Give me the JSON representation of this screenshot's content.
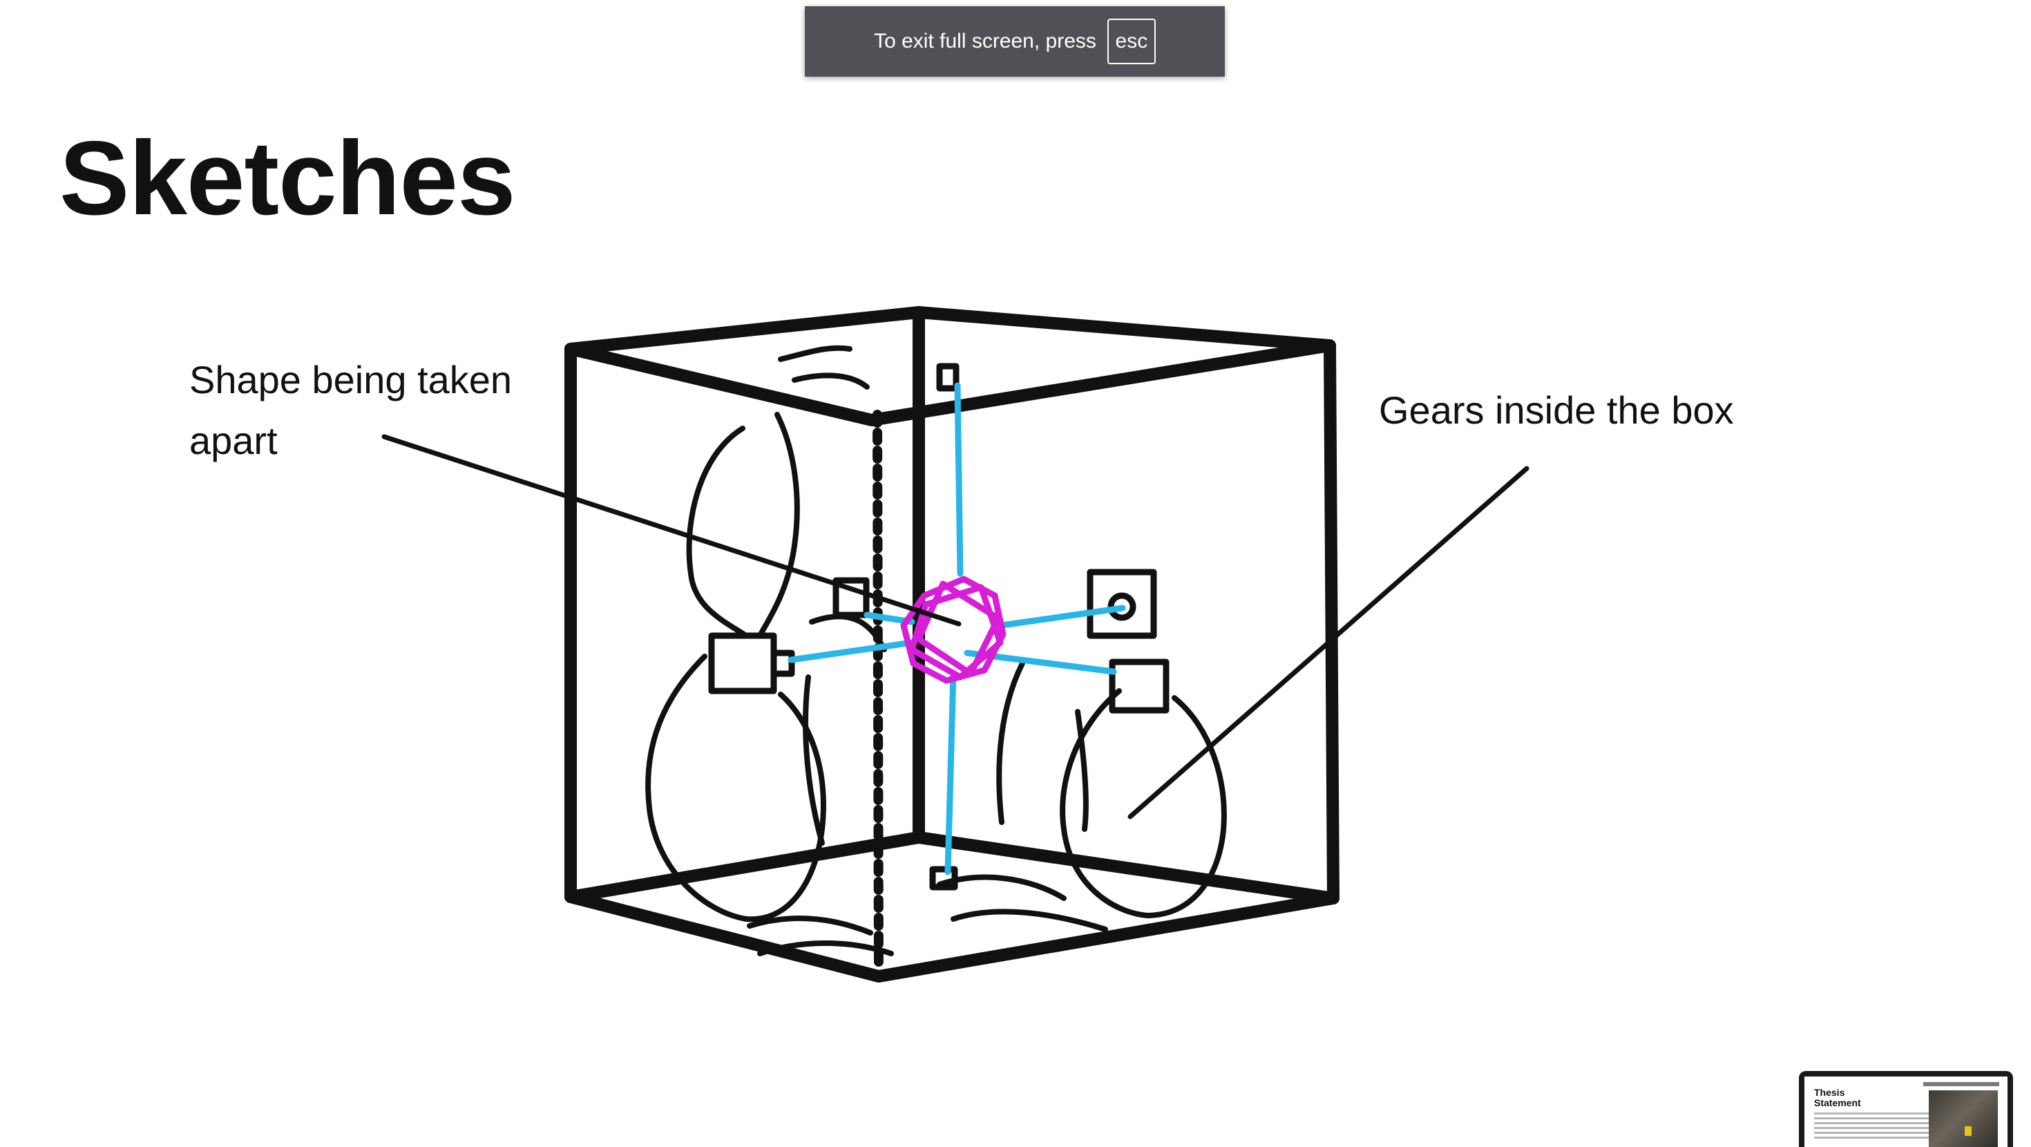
{
  "fullscreen_notice": {
    "text": "To exit full screen, press",
    "key": "esc"
  },
  "slide": {
    "title": "Sketches",
    "annotations": {
      "left": [
        "Shape being taken",
        "apart"
      ],
      "right": "Gears inside the box"
    }
  },
  "thumbnail": {
    "title_line1": "Thesis",
    "title_line2": "Statement"
  },
  "colors": {
    "ink": "#111111",
    "axis_blue": "#29b6e6",
    "shape_magenta": "#d61fd6",
    "notice_bg": "#505156"
  }
}
